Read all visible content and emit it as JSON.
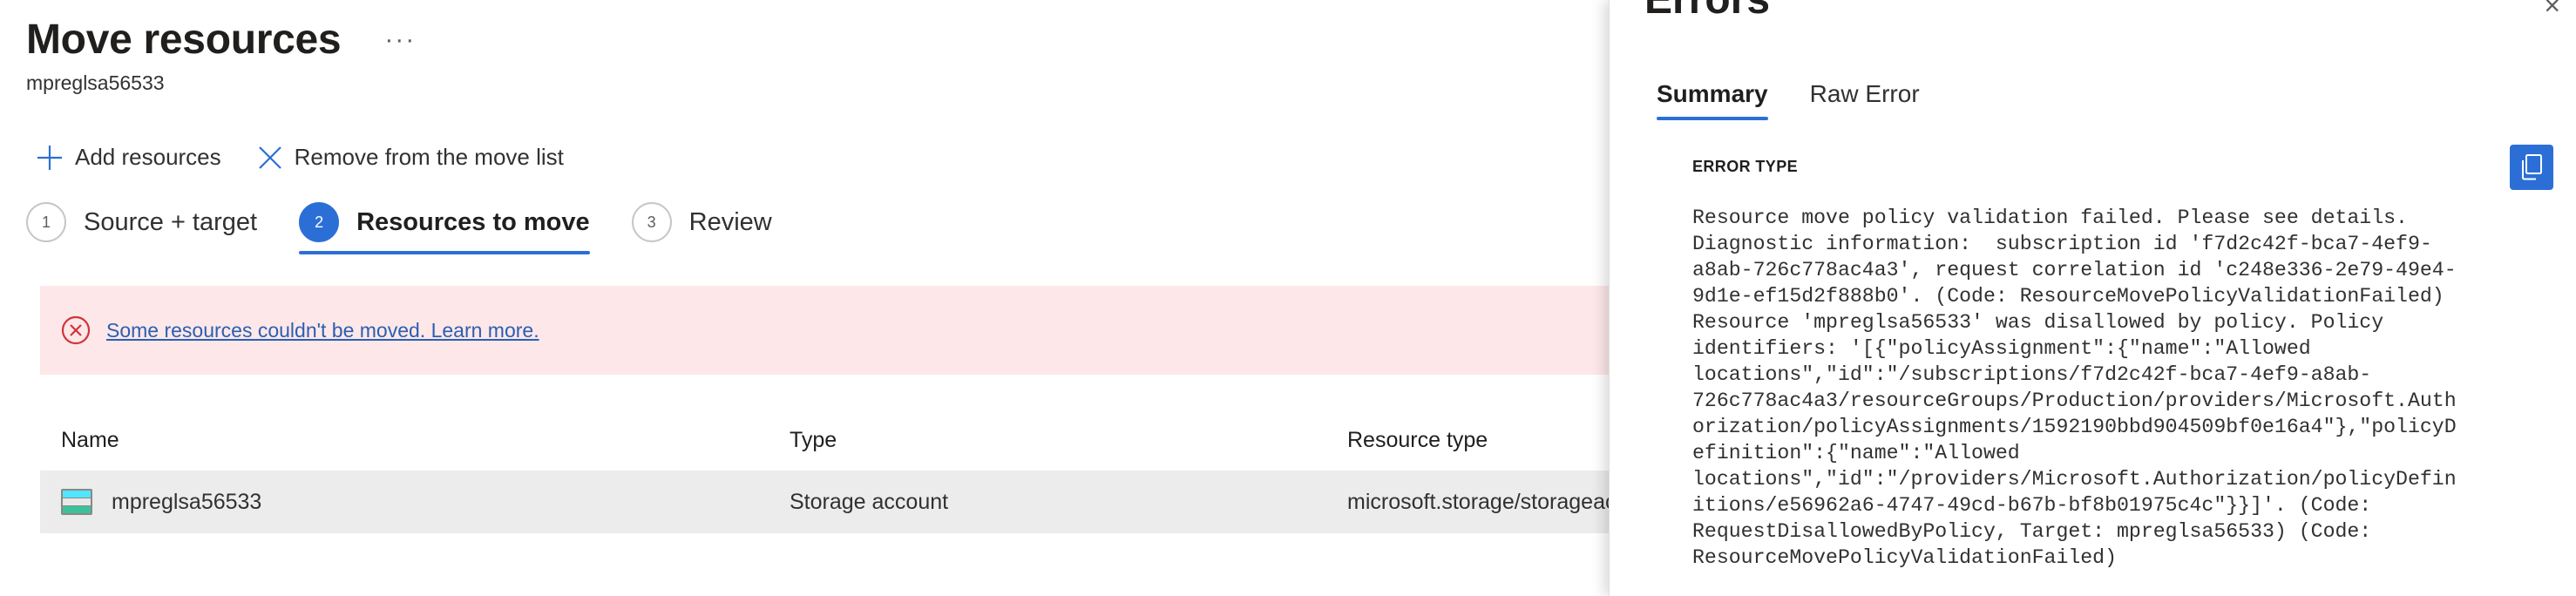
{
  "page": {
    "title": "Move resources",
    "more_label": "···",
    "subtitle": "mpreglsa56533"
  },
  "toolbar": {
    "add_label": "Add resources",
    "remove_label": "Remove from the move list"
  },
  "steps": [
    {
      "number": "1",
      "label": "Source + target",
      "active": false
    },
    {
      "number": "2",
      "label": "Resources to move",
      "active": true
    },
    {
      "number": "3",
      "label": "Review",
      "active": false
    }
  ],
  "alert": {
    "message": "Some resources couldn't be moved. Learn more."
  },
  "table": {
    "headers": {
      "name": "Name",
      "type": "Type",
      "resource_type": "Resource type"
    },
    "rows": [
      {
        "name": "mpreglsa56533",
        "type": "Storage account",
        "resource_type": "microsoft.storage/storageaccounts"
      }
    ]
  },
  "panel": {
    "title": "Errors",
    "close_label": "×",
    "tabs": [
      {
        "label": "Summary",
        "active": true
      },
      {
        "label": "Raw Error",
        "active": false
      }
    ],
    "error_type_label": "ERROR TYPE",
    "error_text": "Resource move policy validation failed. Please see details.\nDiagnostic information:  subscription id 'f7d2c42f-bca7-4ef9-\na8ab-726c778ac4a3', request correlation id 'c248e336-2e79-49e4-\n9d1e-ef15d2f888b0'. (Code: ResourceMovePolicyValidationFailed)\nResource 'mpreglsa56533' was disallowed by policy. Policy\nidentifiers: '[{\"policyAssignment\":{\"name\":\"Allowed\nlocations\",\"id\":\"/subscriptions/f7d2c42f-bca7-4ef9-a8ab-\n726c778ac4a3/resourceGroups/Production/providers/Microsoft.Auth\norization/policyAssignments/1592190bbd904509bf0e16a4\"},\"policyD\nefinition\":{\"name\":\"Allowed\nlocations\",\"id\":\"/providers/Microsoft.Authorization/policyDefin\nitions/e56962a6-4747-49cd-b67b-bf8b01975c4c\"}}]'. (Code:\nRequestDisallowedByPolicy, Target: mpreglsa56533) (Code:\nResourceMovePolicyValidationFailed)"
  },
  "colors": {
    "accent": "#2b6fd6",
    "alert_bg": "#fde7e9",
    "error_red": "#d13438",
    "row_selected": "#ececec"
  },
  "icons": {
    "add": "plus-icon",
    "remove": "close-x-icon",
    "alert": "error-circle-icon",
    "storage": "storage-account-icon",
    "copy": "copy-icon"
  }
}
